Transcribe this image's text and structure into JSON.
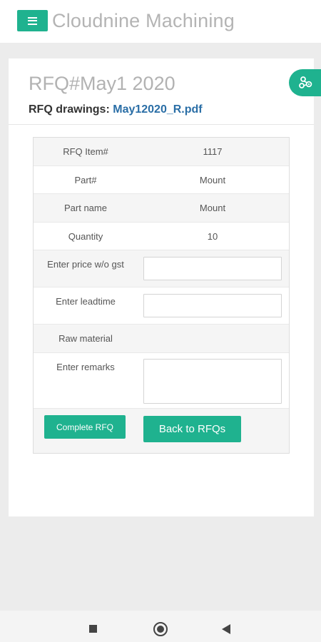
{
  "app": {
    "title": "Cloudnine Machining"
  },
  "rfq": {
    "title": "RFQ#May1 2020",
    "drawings_label": "RFQ drawings:",
    "drawings_file": "May12020_R.pdf"
  },
  "table": {
    "item_label": "RFQ Item#",
    "item_value": "1117",
    "part_label": "Part#",
    "part_value": "Mount",
    "partname_label": "Part name",
    "partname_value": "Mount",
    "quantity_label": "Quantity",
    "quantity_value": "10",
    "price_label": "Enter price w/o gst",
    "price_value": "",
    "leadtime_label": "Enter leadtime",
    "leadtime_value": "",
    "raw_label": "Raw material",
    "remarks_label": "Enter remarks",
    "remarks_value": ""
  },
  "buttons": {
    "complete_label": "Complete RFQ",
    "back_label": "Back to RFQs"
  },
  "colors": {
    "accent": "#1fb28f",
    "link": "#2a6ea6"
  },
  "icons": {
    "menu": "hamburger-menu-icon",
    "fab": "share-nodes-icon",
    "nav_recents": "square-icon",
    "nav_home": "circle-icon",
    "nav_back": "triangle-back-icon"
  }
}
